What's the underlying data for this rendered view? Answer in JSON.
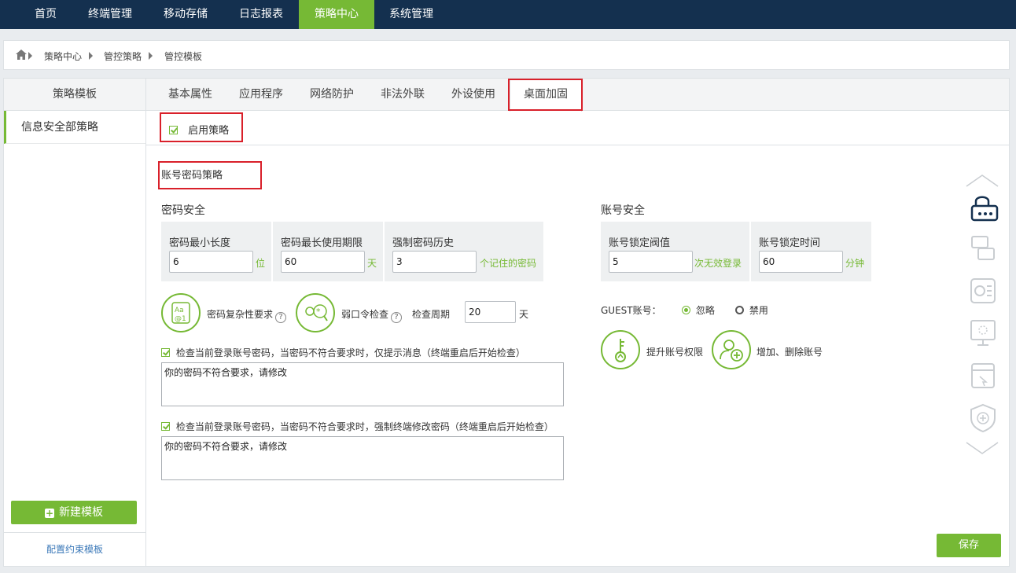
{
  "topnav": [
    "首页",
    "终端管理",
    "移动存储",
    "日志报表",
    "策略中心",
    "系统管理"
  ],
  "breadcrumb": [
    "策略中心",
    "管控策略",
    "管控模板"
  ],
  "sidebar": {
    "title": "策略模板",
    "item": "信息安全部策略",
    "new_button": "新建模板",
    "footer_link": "配置约束模板"
  },
  "tabs": [
    "基本属性",
    "应用程序",
    "网络防护",
    "非法外联",
    "外设使用",
    "桌面加固"
  ],
  "enable_label": "启用策略",
  "section_title": "账号密码策略",
  "password": {
    "title": "密码安全",
    "min_len": {
      "label": "密码最小长度",
      "value": "6",
      "unit": "位"
    },
    "max_age": {
      "label": "密码最长使用期限",
      "value": "60",
      "unit": "天"
    },
    "history": {
      "label": "强制密码历史",
      "value": "3",
      "unit": "个记住的密码"
    },
    "complexity_label": "密码复杂性要求",
    "weak_label": "弱口令检查",
    "period_label": "检查周期",
    "period_value": "20",
    "period_unit": "天",
    "check1": "检查当前登录账号密码，当密码不符合要求时，仅提示消息（终端重启后开始检查）",
    "msg1": "你的密码不符合要求，请修改",
    "check2": "检查当前登录账号密码，当密码不符合要求时，强制终端修改密码（终端重启后开始检查）",
    "msg2": "你的密码不符合要求，请修改"
  },
  "account": {
    "title": "账号安全",
    "lock_threshold": {
      "label": "账号锁定阀值",
      "value": "5",
      "unit": "次无效登录"
    },
    "lock_time": {
      "label": "账号锁定时间",
      "value": "60",
      "unit": "分钟"
    },
    "guest_label": "GUEST账号：",
    "guest_ignore": "忽略",
    "guest_disable": "禁用",
    "elevate_label": "提升账号权限",
    "adddel_label": "增加、删除账号"
  },
  "save_label": "保存",
  "colors": {
    "nav": "#14304f",
    "accent": "#76b935",
    "highlight": "#d9202a"
  }
}
